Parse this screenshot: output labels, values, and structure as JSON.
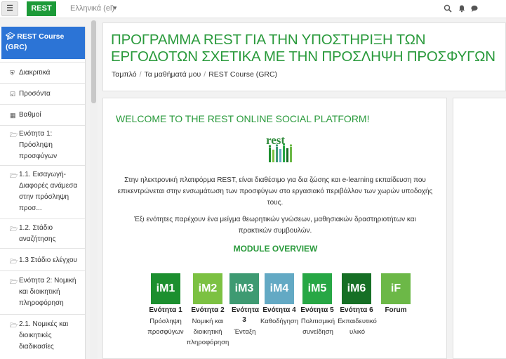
{
  "navbar": {
    "menu_icon": "hamburger-icon",
    "brand": "REST",
    "language": "Ελληνικά (el)",
    "icons": [
      "search-icon",
      "bell-icon",
      "chat-icon"
    ]
  },
  "sidebar": {
    "course": "REST Course (GRC)",
    "items": [
      {
        "icon": "shield-icon",
        "label": "Διακριτικά"
      },
      {
        "icon": "check-square-icon",
        "label": "Προσόντα"
      },
      {
        "icon": "table-icon",
        "label": "Βαθμοί"
      },
      {
        "icon": "folder-icon",
        "label": "Ενότητα 1: Πρόσληψη προσφύγων"
      },
      {
        "icon": "folder-icon",
        "label": "1.1. Εισαγωγή- Διαφορές ανάμεσα στην πρόσληψη προσ..."
      },
      {
        "icon": "folder-icon",
        "label": "1.2. Στάδιο αναζήτησης"
      },
      {
        "icon": "folder-icon",
        "label": "1.3 Στάδιο ελέγχου"
      },
      {
        "icon": "folder-icon",
        "label": "Ενότητα 2: Νομική και διοικητική πληροφόρηση"
      },
      {
        "icon": "folder-icon",
        "label": "2.1. Νομικές και διοικητικές διαδικασίες"
      }
    ]
  },
  "header": {
    "title": "ΠΡΟΓΡΑΜΜΑ REST ΓΙΑ ΤΗΝ ΥΠΟΣΤΗΡΙΞΗ ΤΩΝ ΕΡΓΟΔΟΤΩΝ ΣΧΕΤΙΚΑ ΜΕ ΤΗΝ ΠΡΟΣΛΗΨΗ ΠΡΟΣΦΥΓΩΝ",
    "breadcrumb": [
      "Ταμπλό",
      "Τα μαθήματά μου",
      "REST Course (GRC)"
    ]
  },
  "main": {
    "welcome": "WELCOME TO THE REST ONLINE SOCIAL PLATFORM!",
    "logo_text": "rest",
    "paragraph1": "Στην ηλεκτρονική πλατφόρμα REST, είναι διαθέσιμο για δια ζώσης και e-learning εκπαίδευση που επικεντρώνεται στην ενσωμάτωση των προσφύγων στο εργασιακό περιβάλλον των χωρών υποδοχής τους.",
    "paragraph2": "Έξι ενότητες παρέχουν ένα μείγμα θεωρητικών γνώσεων, μαθησιακών δραστηριοτήτων και πρακτικών συμβουλών.",
    "module_overview": "MODULE OVERVIEW",
    "modules": [
      {
        "code": "iM1",
        "label": "Ενότητα 1",
        "desc": "Πρόσληψη προσφύγων",
        "color": "#1c8f2f"
      },
      {
        "code": "iM2",
        "label": "Ενότητα 2",
        "desc": "Νομική και διοικητική πληροφόρηση",
        "color": "#7cc142"
      },
      {
        "code": "iM3",
        "label": "Ενότητα 3",
        "desc": "Ένταξη",
        "color": "#3e9a72"
      },
      {
        "code": "iM4",
        "label": "Ενότητα 4",
        "desc": "Καθοδήγηση",
        "color": "#63a9c4"
      },
      {
        "code": "iM5",
        "label": "Ενότητα 5",
        "desc": "Πολιτισμική συνείδηση",
        "color": "#27a745"
      },
      {
        "code": "iM6",
        "label": "Ενότητα 6",
        "desc": "Εκπαιδευτικό υλικό",
        "color": "#166f25"
      },
      {
        "code": "iF",
        "label": "Forum",
        "desc": "",
        "color": "#6cb847"
      }
    ]
  }
}
